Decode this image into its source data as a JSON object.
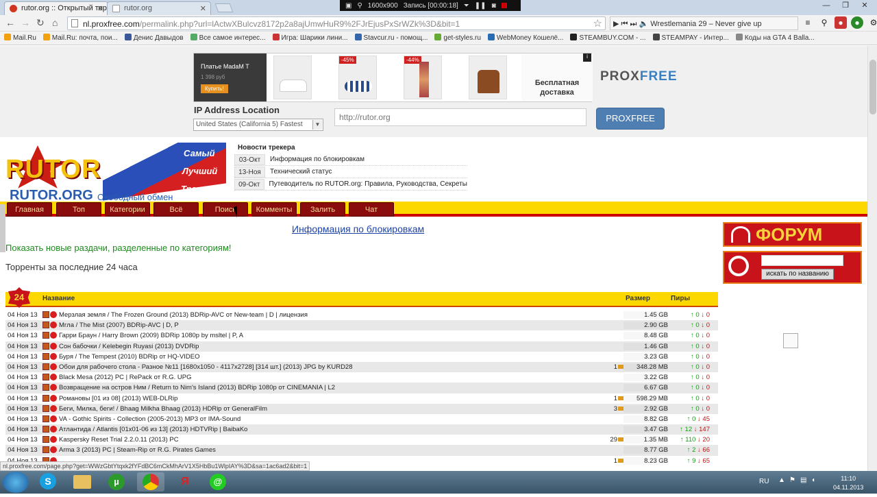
{
  "browser": {
    "tabs": [
      {
        "label": "rutor.org :: Открытый тор",
        "active": true
      },
      {
        "label": "rutor.org",
        "active": false
      }
    ],
    "recorder": {
      "resolution": "1600x900",
      "record": "Запись [00:00:18]"
    },
    "url_prefix": "nl.proxfree.com",
    "url_rest": "/permalink.php?url=lActwXBulcvz8172p2a8ajUmwHuR9%2FJrEjusPxSrWZk%3D&bit=1",
    "media_title": "Wrestlemania 29 – Never give up",
    "bookmarks": [
      "Mail.Ru",
      "Mail.Ru: почта, пои...",
      "Денис Давыдов",
      "Все самое интерес...",
      "Игра: Шарики лини...",
      "Stavcur.ru - помощ...",
      "get-styles.ru",
      "WebMoney Кошелё...",
      "STEAMBUY.COM - ...",
      "STEAMPAY - Интер...",
      "Коды на GTA 4 Balla..."
    ],
    "bookmark_colors": [
      "#f2a010",
      "#f2a010",
      "#3b5998",
      "#5a6",
      "#c33",
      "#36a",
      "#6a3",
      "#2a6db5",
      "#222",
      "#444",
      "#888"
    ]
  },
  "ad": {
    "title": "Платье MadaM T",
    "price": "1 398 руб",
    "buy": "Купить!",
    "discount1": "-45%",
    "discount2": "-44%",
    "shipping": "Бесплатная доставка",
    "logo_a": "PROX",
    "logo_b": "FREE"
  },
  "proxfree": {
    "ip_label": "IP Address Location",
    "location": "United States (California 5) Fastest",
    "url_placeholder": "http://rutor.org",
    "button": "PROXFREE"
  },
  "logo": {
    "big": "RUTOR",
    "slogan1": "Самый",
    "slogan2": "Лучший",
    "slogan3": "Трекер",
    "site": "RUTOR.ORG",
    "tagline": "Свободный обмен"
  },
  "news": {
    "header": "Новости трекера",
    "items": [
      {
        "date": "03-Окт",
        "title": "Информация по блокировкам"
      },
      {
        "date": "13-Ноя",
        "title": "Технический статус"
      },
      {
        "date": "09-Окт",
        "title": "Путеводитель по RUTOR.org: Правила, Руководства, Секреты"
      }
    ]
  },
  "menu": [
    "Главная",
    "Топ",
    "Категории",
    "Всё",
    "Поиск",
    "Комменты",
    "Залить",
    "Чат"
  ],
  "block_link": "Информация по блокировкам",
  "show_new": "Показать новые раздачи, разделенные по категориям!",
  "last24": "Торренты за последние 24 часа",
  "badge": "24",
  "side": {
    "forum": "ФОРУМ",
    "search_button": "искать по названию"
  },
  "table": {
    "headers": {
      "name": "Название",
      "size": "Размер",
      "peers": "Пиры"
    },
    "rows": [
      {
        "date": "04 Ноя 13",
        "name": "Мерзлая земля / The Frozen Ground (2013) BDRip-AVC от New-team | D | лицензия",
        "comments": "",
        "size": "1.45 GB",
        "up": "0",
        "down": "0"
      },
      {
        "date": "04 Ноя 13",
        "name": "Мгла / The Mist (2007) BDRip-AVC | D, P",
        "comments": "",
        "size": "2.90 GB",
        "up": "0",
        "down": "0"
      },
      {
        "date": "04 Ноя 13",
        "name": "Гарри Браун / Harry Brown (2009) BDRip 1080p by msltel | P, A",
        "comments": "",
        "size": "8.48 GB",
        "up": "0",
        "down": "0"
      },
      {
        "date": "04 Ноя 13",
        "name": "Сон бабочки / Kelebegin Ruyasi (2013) DVDRip",
        "comments": "",
        "size": "1.46 GB",
        "up": "0",
        "down": "0"
      },
      {
        "date": "04 Ноя 13",
        "name": "Буря / The Tempest (2010) BDRip от HQ-VIDEO",
        "comments": "",
        "size": "3.23 GB",
        "up": "0",
        "down": "0"
      },
      {
        "date": "04 Ноя 13",
        "name": "Обои для рабочего стола - Разное №11 [1680x1050 - 4117x2728] [314 шт.] (2013) JPG by KURD28",
        "comments": "1",
        "size": "348.28 MB",
        "up": "0",
        "down": "0"
      },
      {
        "date": "04 Ноя 13",
        "name": "Black Mesa (2012) PC | RePack от R.G. UPG",
        "comments": "",
        "size": "3.22 GB",
        "up": "0",
        "down": "0"
      },
      {
        "date": "04 Ноя 13",
        "name": "Возвращение на остров Ним / Return to Nim's Island (2013) BDRip 1080p от CINEMANIA | L2",
        "comments": "",
        "size": "6.67 GB",
        "up": "0",
        "down": "0"
      },
      {
        "date": "04 Ноя 13",
        "name": "Романовы [01 из 08] (2013) WEB-DLRip",
        "comments": "1",
        "size": "598.29 MB",
        "up": "0",
        "down": "0"
      },
      {
        "date": "04 Ноя 13",
        "name": "Беги, Милка, беги! / Bhaag Milkha Bhaag (2013) HDRip от GeneralFilm",
        "comments": "3",
        "size": "2.92 GB",
        "up": "0",
        "down": "0"
      },
      {
        "date": "04 Ноя 13",
        "name": "VA - Gothic Spirits - Collection (2005-2013) MP3 от IMA-Sound",
        "comments": "",
        "size": "8.82 GB",
        "up": "0",
        "down": "45"
      },
      {
        "date": "04 Ноя 13",
        "name": "Атлантида / Atlantis [01x01-06 из 13] (2013) HDTVRip | BaibaKo",
        "comments": "",
        "size": "3.47 GB",
        "up": "12",
        "down": "147"
      },
      {
        "date": "04 Ноя 13",
        "name": "Kaspersky Reset Trial 2.2.0.11 (2013) PC",
        "comments": "29",
        "size": "1.35 MB",
        "up": "110",
        "down": "20"
      },
      {
        "date": "04 Ноя 13",
        "name": "Arma 3 (2013) PC | Steam-Rip от R.G. Pirates Games",
        "comments": "",
        "size": "8.77 GB",
        "up": "2",
        "down": "66"
      },
      {
        "date": "04 Ноя 13",
        "name": "",
        "comments": "1",
        "size": "8.23 GB",
        "up": "9",
        "down": "65"
      }
    ]
  },
  "status_url": "nl.proxfree.com/page.php?get=WWzGbtYtqxk2fYFdBC6mCkMhArV1X5HbBu1WlpIAY%3D&sa=1ac6ad2&bit=1",
  "taskbar": {
    "lang": "RU",
    "time": "11:10",
    "date": "04.11.2013"
  }
}
